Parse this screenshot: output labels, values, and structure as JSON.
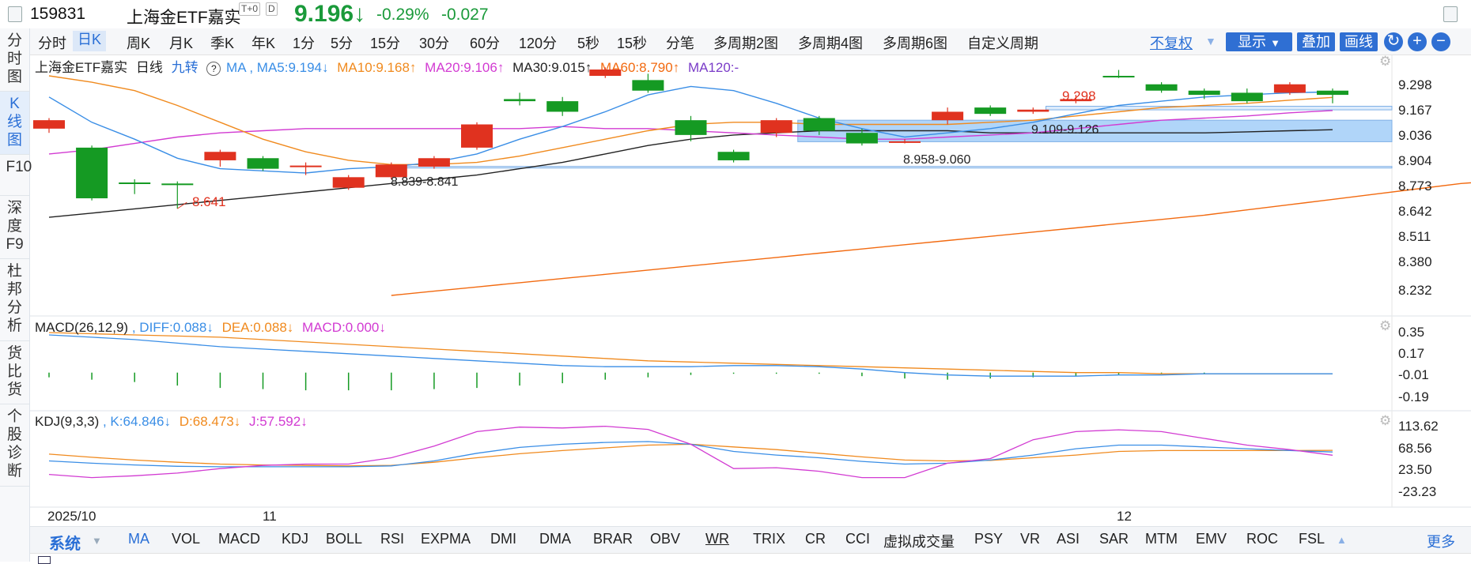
{
  "header": {
    "code": "159831",
    "name": "上海金ETF嘉实",
    "tag_t0": "T+0",
    "tag_d": "D",
    "price": "9.196↓",
    "change_pct": "-0.29%",
    "change_abs": "-0.027"
  },
  "leftnav": [
    "分时图",
    "K线图",
    "F10",
    "深度F9",
    "杜邦分析",
    "货比货",
    "个股诊断"
  ],
  "tabs": [
    "分时",
    "日K",
    "周K",
    "月K",
    "季K",
    "年K",
    "1分",
    "5分",
    "15分",
    "30分",
    "60分",
    "120分",
    "5秒",
    "15秒",
    "分笔",
    "多周期2图",
    "多周期4图",
    "多周期6图",
    "自定义周期"
  ],
  "toolbar": {
    "adjust": "不复权",
    "display": "显示",
    "overlay": "叠加",
    "draw": "画线"
  },
  "main_legend": {
    "name": "上海金ETF嘉实",
    "period": "日线",
    "nine": "九转",
    "ma": "MA",
    "ma5": ", MA5:9.194↓",
    "ma10": "MA10:9.168↑",
    "ma20": "MA20:9.106↑",
    "ma30": "MA30:9.015↑",
    "ma60": "MA60:8.790↑",
    "ma120": "MA120:-"
  },
  "main_axis": [
    "9.298",
    "9.167",
    "9.036",
    "8.904",
    "8.773",
    "8.642",
    "8.511",
    "8.380",
    "8.232"
  ],
  "annotations": {
    "low": "8.641",
    "high": "9.298",
    "zone1": "8.839-8.841",
    "zone2": "8.958-9.060",
    "zone3": "9.109-9.126"
  },
  "macd_legend": {
    "name": "MACD(26,12,9)",
    "diff": ", DIFF:0.088↓",
    "dea": "DEA:0.088↓",
    "macd": "MACD:0.000↓"
  },
  "macd_axis": [
    "0.35",
    "0.17",
    "-0.01",
    "-0.19"
  ],
  "kdj_legend": {
    "name": "KDJ(9,3,3)",
    "k": ", K:64.846↓",
    "d": "D:68.473↓",
    "j": "J:57.592↓"
  },
  "kdj_axis": [
    "113.62",
    "68.56",
    "23.50",
    "-23.23"
  ],
  "xaxis": [
    "2025/10",
    "11",
    "12"
  ],
  "indicators": {
    "system": "系统",
    "items": [
      "MA",
      "VOL",
      "MACD",
      "KDJ",
      "BOLL",
      "RSI",
      "EXPMA",
      "DMI",
      "DMA",
      "BRAR",
      "OBV",
      "WR",
      "TRIX",
      "CR",
      "CCI",
      "虚拟成交量",
      "PSY",
      "VR",
      "ASI",
      "SAR",
      "MTM",
      "EMV",
      "ROC",
      "FSL"
    ],
    "more": "更多"
  },
  "colors": {
    "up": "#e0321f",
    "down": "#159a23",
    "ma5": "#3a8ee6",
    "ma10": "#f08a1e",
    "ma20": "#d23bd2",
    "ma30": "#222222",
    "ma60": "#f26a10",
    "ma120": "#7a3cc8",
    "accent": "#2f6fd3"
  },
  "chart_data": {
    "type": "candlestick",
    "candles": [
      {
        "o": 9.02,
        "c": 9.06,
        "h": 9.07,
        "l": 9.0
      },
      {
        "o": 8.93,
        "c": 8.69,
        "h": 8.94,
        "l": 8.68
      },
      {
        "o": 8.765,
        "c": 8.76,
        "h": 8.78,
        "l": 8.71
      },
      {
        "o": 8.76,
        "c": 8.758,
        "h": 8.77,
        "l": 8.641
      },
      {
        "o": 8.87,
        "c": 8.91,
        "h": 8.92,
        "l": 8.84
      },
      {
        "o": 8.88,
        "c": 8.83,
        "h": 8.89,
        "l": 8.82
      },
      {
        "o": 8.84,
        "c": 8.845,
        "h": 8.86,
        "l": 8.8
      },
      {
        "o": 8.74,
        "c": 8.79,
        "h": 8.8,
        "l": 8.73
      },
      {
        "o": 8.79,
        "c": 8.85,
        "h": 8.86,
        "l": 8.78
      },
      {
        "o": 8.84,
        "c": 8.88,
        "h": 8.89,
        "l": 8.83
      },
      {
        "o": 8.93,
        "c": 9.04,
        "h": 9.05,
        "l": 8.92
      },
      {
        "o": 9.16,
        "c": 9.15,
        "h": 9.19,
        "l": 9.13
      },
      {
        "o": 9.15,
        "c": 9.1,
        "h": 9.17,
        "l": 9.08
      },
      {
        "o": 9.27,
        "c": 9.3,
        "h": 9.31,
        "l": 9.26
      },
      {
        "o": 9.25,
        "c": 9.2,
        "h": 9.28,
        "l": 9.19
      },
      {
        "o": 9.06,
        "c": 8.99,
        "h": 9.08,
        "l": 8.96
      },
      {
        "o": 8.91,
        "c": 8.87,
        "h": 8.92,
        "l": 8.86
      },
      {
        "o": 9.0,
        "c": 9.06,
        "h": 9.07,
        "l": 8.98
      },
      {
        "o": 9.07,
        "c": 9.01,
        "h": 9.08,
        "l": 8.99
      },
      {
        "o": 9.0,
        "c": 8.95,
        "h": 9.02,
        "l": 8.94
      },
      {
        "o": 8.955,
        "c": 8.96,
        "h": 8.97,
        "l": 8.95
      },
      {
        "o": 9.06,
        "c": 9.1,
        "h": 9.12,
        "l": 9.04
      },
      {
        "o": 9.12,
        "c": 9.09,
        "h": 9.13,
        "l": 9.08
      },
      {
        "o": 9.1,
        "c": 9.11,
        "h": 9.12,
        "l": 9.09
      },
      {
        "o": 9.15,
        "c": 9.16,
        "h": 9.18,
        "l": 9.14
      },
      {
        "o": 9.27,
        "c": 9.268,
        "h": 9.298,
        "l": 9.26
      },
      {
        "o": 9.23,
        "c": 9.2,
        "h": 9.24,
        "l": 9.19
      },
      {
        "o": 9.2,
        "c": 9.18,
        "h": 9.21,
        "l": 9.16
      },
      {
        "o": 9.19,
        "c": 9.15,
        "h": 9.21,
        "l": 9.14
      },
      {
        "o": 9.19,
        "c": 9.23,
        "h": 9.24,
        "l": 9.18
      },
      {
        "o": 9.2,
        "c": 9.18,
        "h": 9.21,
        "l": 9.14
      }
    ],
    "ma5": [
      9.17,
      9.05,
      8.97,
      8.88,
      8.83,
      8.82,
      8.81,
      8.83,
      8.84,
      8.86,
      8.9,
      8.97,
      9.03,
      9.1,
      9.18,
      9.22,
      9.2,
      9.14,
      9.07,
      9.02,
      8.98,
      9.0,
      9.02,
      9.05,
      9.09,
      9.13,
      9.15,
      9.17,
      9.18,
      9.19,
      9.194
    ],
    "ma10": [
      9.27,
      9.24,
      9.2,
      9.13,
      9.05,
      8.97,
      8.91,
      8.87,
      8.85,
      8.85,
      8.86,
      8.89,
      8.93,
      8.97,
      9.01,
      9.04,
      9.05,
      9.05,
      9.04,
      9.04,
      9.04,
      9.04,
      9.05,
      9.06,
      9.08,
      9.1,
      9.12,
      9.13,
      9.14,
      9.155,
      9.168
    ],
    "ma20": [
      8.9,
      8.92,
      8.95,
      8.98,
      9.0,
      9.01,
      9.02,
      9.02,
      9.02,
      9.02,
      9.02,
      9.02,
      9.03,
      9.02,
      9.02,
      9.01,
      9.0,
      8.99,
      8.98,
      8.97,
      8.97,
      8.98,
      8.99,
      9.0,
      9.02,
      9.04,
      9.06,
      9.07,
      9.08,
      9.095,
      9.106
    ],
    "ma30": [
      8.6,
      8.62,
      8.64,
      8.66,
      8.68,
      8.7,
      8.72,
      8.74,
      8.76,
      8.78,
      8.8,
      8.83,
      8.86,
      8.9,
      8.94,
      8.97,
      8.99,
      9.0,
      9.01,
      9.01,
      9.01,
      9.01,
      9.0,
      9.0,
      9.0,
      9.0,
      9.0,
      9.0,
      9.005,
      9.01,
      9.015
    ],
    "ma60_start_index": 8,
    "ma60": [
      8.23,
      8.25,
      8.27,
      8.29,
      8.31,
      8.33,
      8.35,
      8.37,
      8.39,
      8.41,
      8.43,
      8.45,
      8.47,
      8.49,
      8.51,
      8.53,
      8.55,
      8.57,
      8.59,
      8.61,
      8.635,
      8.66,
      8.685,
      8.71,
      8.735,
      8.76,
      8.775,
      8.79
    ],
    "ylim": [
      8.2,
      9.33
    ],
    "zones": [
      {
        "low": 8.839,
        "high": 8.841
      },
      {
        "low": 8.958,
        "high": 9.06
      },
      {
        "low": 9.109,
        "high": 9.126
      }
    ],
    "macd": {
      "diff": [
        0.32,
        0.3,
        0.28,
        0.25,
        0.22,
        0.2,
        0.18,
        0.16,
        0.14,
        0.12,
        0.1,
        0.08,
        0.06,
        0.05,
        0.05,
        0.05,
        0.06,
        0.06,
        0.05,
        0.03,
        0.0,
        -0.02,
        -0.03,
        -0.03,
        -0.03,
        -0.02,
        -0.02,
        -0.01,
        -0.01,
        -0.01,
        -0.01
      ],
      "dea": [
        0.34,
        0.33,
        0.32,
        0.31,
        0.3,
        0.28,
        0.26,
        0.24,
        0.22,
        0.2,
        0.18,
        0.16,
        0.14,
        0.12,
        0.1,
        0.09,
        0.08,
        0.07,
        0.06,
        0.05,
        0.04,
        0.03,
        0.02,
        0.01,
        0.0,
        0.0,
        -0.01,
        -0.01,
        -0.01,
        -0.01,
        -0.01
      ],
      "hist": [
        -0.04,
        -0.06,
        -0.08,
        -0.11,
        -0.13,
        -0.14,
        -0.15,
        -0.15,
        -0.15,
        -0.14,
        -0.13,
        -0.11,
        -0.09,
        -0.06,
        -0.04,
        -0.02,
        -0.01,
        -0.01,
        -0.01,
        -0.03,
        -0.05,
        -0.06,
        -0.05,
        -0.04,
        -0.03,
        -0.02,
        -0.01,
        -0.01,
        0.0,
        0.0,
        0.0
      ],
      "ylim": [
        -0.27,
        0.38
      ]
    },
    "kdj": {
      "k": [
        45,
        40,
        36,
        33,
        32,
        32,
        32,
        32,
        34,
        45,
        62,
        75,
        82,
        86,
        88,
        82,
        66,
        58,
        52,
        44,
        38,
        40,
        47,
        58,
        72,
        80,
        80,
        76,
        72,
        68,
        64.846
      ],
      "d": [
        60,
        53,
        47,
        42,
        38,
        36,
        35,
        34,
        35,
        42,
        52,
        61,
        68,
        74,
        80,
        82,
        76,
        70,
        62,
        54,
        47,
        45,
        46,
        52,
        58,
        66,
        68,
        68,
        68,
        68,
        68.473
      ],
      "j": [
        15,
        8,
        12,
        18,
        28,
        35,
        38,
        38,
        52,
        78,
        110,
        120,
        118,
        122,
        115,
        82,
        28,
        30,
        22,
        8,
        8,
        40,
        50,
        92,
        110,
        114,
        110,
        95,
        80,
        70,
        57.592
      ],
      "ylim": [
        -40,
        130
      ]
    }
  }
}
